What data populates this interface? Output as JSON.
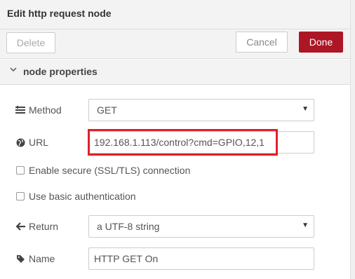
{
  "header": {
    "title": "Edit http request node"
  },
  "toolbar": {
    "delete_label": "Delete",
    "cancel_label": "Cancel",
    "done_label": "Done"
  },
  "section": {
    "label": "node properties",
    "chevron": "⌄"
  },
  "fields": {
    "method": {
      "label": "Method",
      "value": "GET",
      "icon": "list-icon"
    },
    "url": {
      "label": "URL",
      "value": "192.168.1.113/control?cmd=GPIO,12,1",
      "icon": "globe-icon"
    },
    "tls": {
      "label": "Enable secure (SSL/TLS) connection",
      "checked": false
    },
    "auth": {
      "label": "Use basic authentication",
      "checked": false
    },
    "ret": {
      "label": "Return",
      "value": "a UTF-8 string",
      "icon": "arrow-left-icon"
    },
    "name": {
      "label": "Name",
      "value": "HTTP GET On",
      "icon": "tag-icon"
    }
  },
  "colors": {
    "done": "#ad1625",
    "highlight": "#e0202a"
  }
}
